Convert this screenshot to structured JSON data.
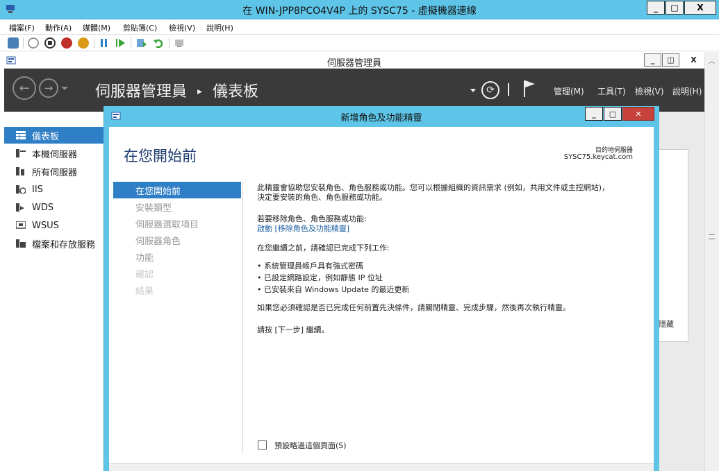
{
  "vm_window": {
    "title": "在 WIN-JPP8PCO4V4P 上的 SYSC75 - 虛擬機器連線",
    "controls": {
      "minimize": "_",
      "maximize": "□",
      "close": "X"
    }
  },
  "vm_menu": [
    "檔案(F)",
    "動作(A)",
    "媒體(M)",
    "剪貼簿(C)",
    "檢視(V)",
    "說明(H)"
  ],
  "vm_toolbar_icons": [
    "ctrl-alt-del-icon",
    "start-icon",
    "turn-off-icon",
    "shut-down-icon",
    "save-icon",
    "pause-icon",
    "reset-icon",
    "checkpoint-icon",
    "revert-icon",
    "enhanced-session-icon"
  ],
  "server_manager": {
    "title": "伺服器管理員",
    "breadcrumb_app": "伺服器管理員",
    "breadcrumb_sep": "▸",
    "breadcrumb_page": "儀表板",
    "menu": [
      "管理(M)",
      "工具(T)",
      "檢視(V)",
      "說明(H)"
    ],
    "sidebar": [
      {
        "label": "儀表板",
        "icon": "dashboard-icon",
        "active": true
      },
      {
        "label": "本機伺服器",
        "icon": "local-server-icon"
      },
      {
        "label": "所有伺服器",
        "icon": "all-servers-icon"
      },
      {
        "label": "IIS",
        "icon": "iis-icon"
      },
      {
        "label": "WDS",
        "icon": "wds-icon"
      },
      {
        "label": "WSUS",
        "icon": "wsus-icon"
      },
      {
        "label": "檔案和存放服務",
        "icon": "file-storage-icon"
      }
    ],
    "behind_text": "隱藏"
  },
  "wizard": {
    "title": "新增角色及功能精靈",
    "page_title": "在您開始前",
    "dest_label": "目的地伺服器",
    "dest_server": "SYSC75.keycat.com",
    "steps": [
      {
        "label": "在您開始前",
        "state": "active"
      },
      {
        "label": "安裝類型",
        "state": "normal"
      },
      {
        "label": "伺服器選取項目",
        "state": "normal"
      },
      {
        "label": "伺服器角色",
        "state": "normal"
      },
      {
        "label": "功能",
        "state": "normal"
      },
      {
        "label": "確認",
        "state": "dim"
      },
      {
        "label": "結果",
        "state": "dim"
      }
    ],
    "intro_1": "此精靈會協助您安裝角色、角色服務或功能。您可以根據組織的資訊需求 (例如，共用文件或主控網站)，",
    "intro_2": "決定要安裝的角色、角色服務或功能。",
    "remove_label": "若要移除角色、角色服務或功能:",
    "remove_link": "啟動 [移除角色及功能精靈]",
    "before_label": "在您繼續之前，請確認已完成下列工作:",
    "bullets": [
      "系統管理員帳戶具有強式密碼",
      "已設定網路設定，例如靜態 IP 位址",
      "已安裝來自 Windows Update 的最近更新"
    ],
    "prereq_note": "如果您必須確認是否已完成任何前置先決條件，請關閉精靈、完成步驟，然後再次執行精靈。",
    "continue_note": "請按 [下一步] 繼續。",
    "skip_checkbox": "預設略過這個頁面(S)"
  }
}
